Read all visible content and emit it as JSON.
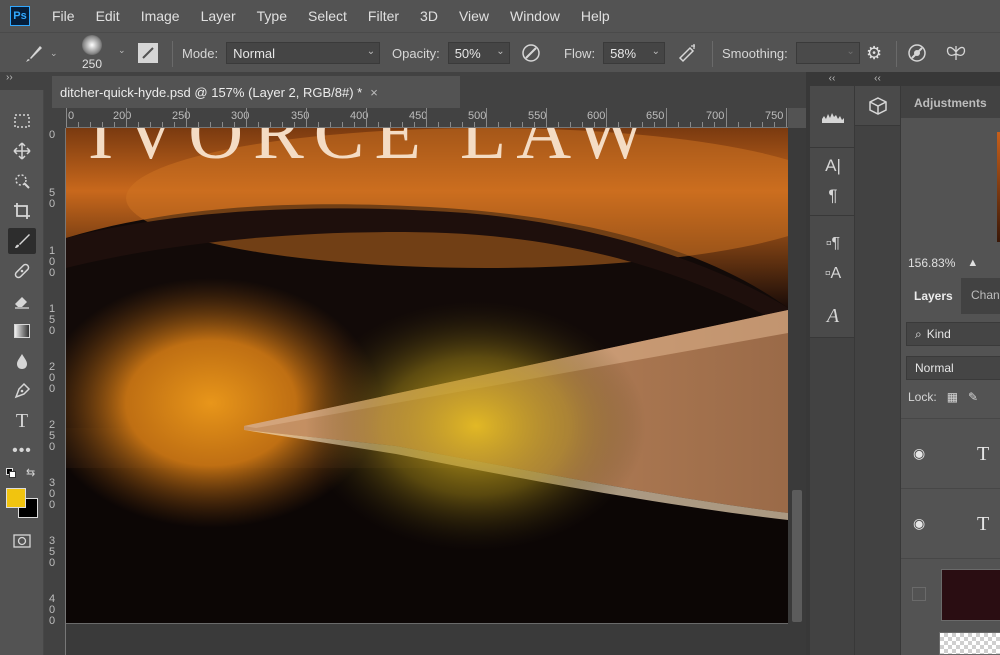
{
  "app": {
    "logo_text": "Ps"
  },
  "menu": [
    "File",
    "Edit",
    "Image",
    "Layer",
    "Type",
    "Select",
    "Filter",
    "3D",
    "View",
    "Window",
    "Help"
  ],
  "options": {
    "brush_size": "250",
    "mode_label": "Mode:",
    "mode_value": "Normal",
    "opacity_label": "Opacity:",
    "opacity_value": "50%",
    "flow_label": "Flow:",
    "flow_value": "58%",
    "smoothing_label": "Smoothing:",
    "smoothing_value": ""
  },
  "collapse_strip": {
    "left": "››",
    "dock": "‹‹",
    "panel": "‹‹"
  },
  "document": {
    "tab_title": "ditcher-quick-hyde.psd @ 157% (Layer 2, RGB/8#) *",
    "close": "×",
    "canvas_text": "IVORCE LAW"
  },
  "ruler_top": [
    "0",
    "200",
    "250",
    "300",
    "350",
    "400",
    "450",
    "500",
    "550",
    "600",
    "650",
    "700",
    "750"
  ],
  "ruler_left": [
    "0",
    "50",
    "100",
    "150",
    "200",
    "250",
    "300",
    "350",
    "400"
  ],
  "colors": {
    "foreground": "#f1c40f",
    "background": "#000000"
  },
  "panels": {
    "adjustments_title": "Adjustments",
    "zoom": "156.83%",
    "layers_tab": "Layers",
    "channels_tab": "Chan",
    "kind_filter": "Kind",
    "blend_mode": "Normal",
    "lock_label": "Lock:",
    "layers": [
      {
        "type_glyph": "T",
        "visible": true
      },
      {
        "type_glyph": "T",
        "visible": true
      },
      {
        "type_glyph": "",
        "visible": false
      }
    ]
  }
}
